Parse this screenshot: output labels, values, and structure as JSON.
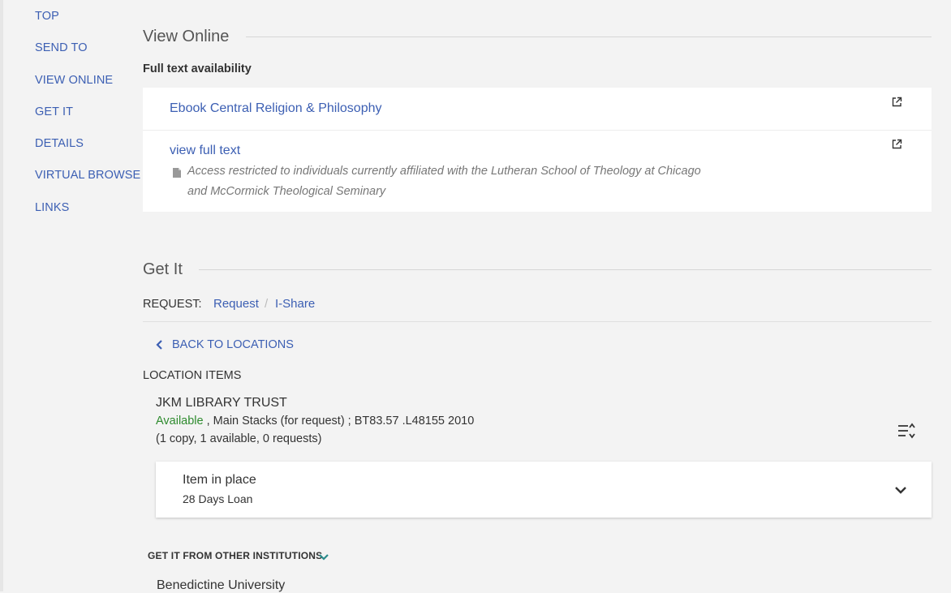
{
  "sidebar": {
    "items": [
      {
        "label": "TOP"
      },
      {
        "label": "SEND TO"
      },
      {
        "label": "VIEW ONLINE"
      },
      {
        "label": "GET IT"
      },
      {
        "label": "DETAILS"
      },
      {
        "label": "VIRTUAL BROWSE"
      },
      {
        "label": "LINKS"
      }
    ]
  },
  "view_online": {
    "title": "View Online",
    "subheading": "Full text availability",
    "services": [
      {
        "label": "Ebook Central Religion & Philosophy",
        "icon": "external-link-icon"
      },
      {
        "label": "view full text",
        "icon": "external-link-icon",
        "note": "Access restricted to individuals currently affiliated with the Lutheran School of Theology at Chicago and McCormick Theological Seminary",
        "note_icon": "note-icon"
      }
    ]
  },
  "get_it": {
    "title": "Get It",
    "request_label": "REQUEST:",
    "request_links": [
      "Request",
      "I-Share"
    ],
    "request_separator": "/",
    "back_label": "BACK TO LOCATIONS",
    "location_items_label": "LOCATION ITEMS",
    "location": {
      "library": "JKM LIBRARY TRUST",
      "status": "Available",
      "details": ", Main Stacks (for request) ; BT83.57 .L48155 2010",
      "copies": "(1 copy, 1 available, 0 requests)"
    },
    "item": {
      "status": "Item in place",
      "policy": "28 Days Loan"
    },
    "other_institutions_label": "GET IT FROM OTHER INSTITUTIONS",
    "other_institutions": [
      {
        "name": "Benedictine University"
      }
    ]
  },
  "colors": {
    "link": "#3c5fb3",
    "available": "#2e8b2e",
    "accent_chevron": "#2a8a8a"
  }
}
